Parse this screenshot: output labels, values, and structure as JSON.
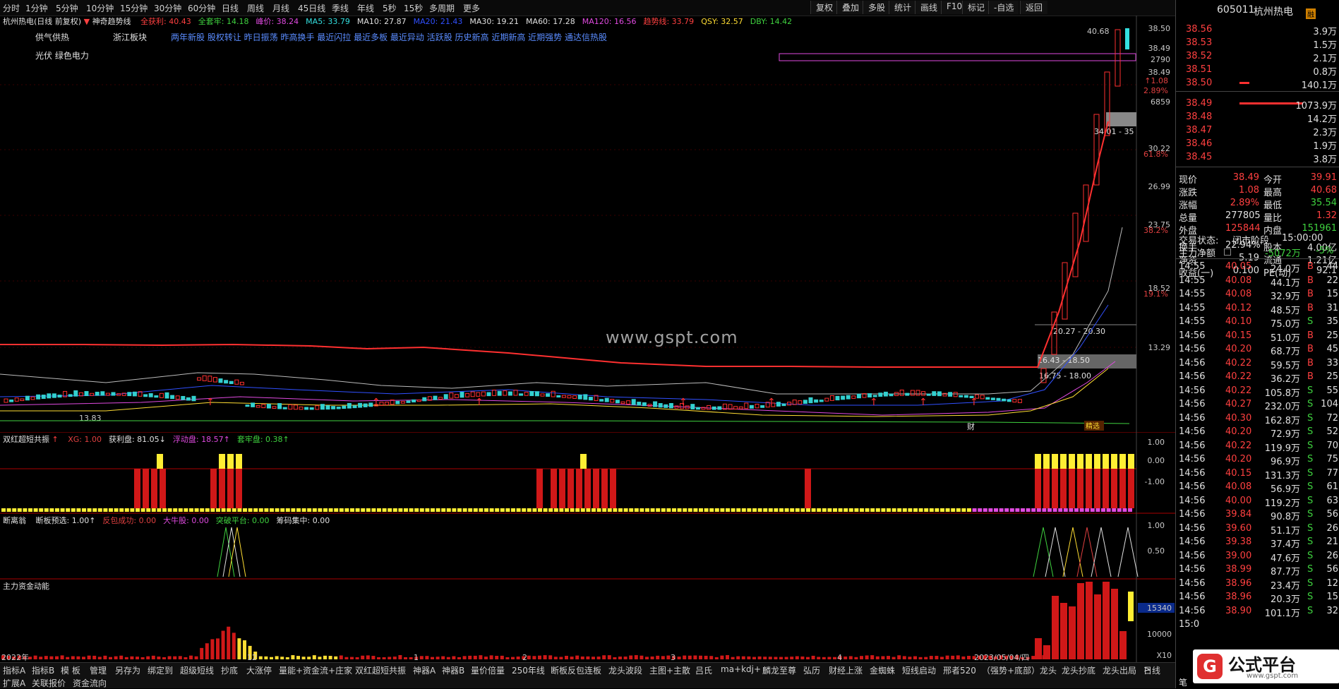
{
  "toolbar": {
    "periods": [
      "分时",
      "1分钟",
      "5分钟",
      "10分钟",
      "15分钟",
      "30分钟",
      "60分钟",
      "日线",
      "周线",
      "月线",
      "45日线",
      "季线",
      "年线",
      "5秒",
      "15秒",
      "多周期",
      "更多"
    ],
    "right_buttons": [
      "复权",
      "叠加",
      "多股",
      "统计",
      "画线",
      "F10",
      "标记",
      "-自选",
      "返回"
    ]
  },
  "main": {
    "stock_label": "杭州热电(日线 前复权)",
    "indicator_name": "神奇趋势线",
    "indicators": [
      {
        "text": "全获利: 40.43",
        "color": "#ff4040"
      },
      {
        "text": "全套牢: 14.18",
        "color": "#3fd23f"
      },
      {
        "text": "峰价: 38.24",
        "color": "#e04ae0"
      },
      {
        "text": "MA5: 33.79",
        "color": "#33e0e0"
      },
      {
        "text": "MA10: 27.87",
        "color": "#e0e0e0"
      },
      {
        "text": "MA20: 21.43",
        "color": "#3050ff"
      },
      {
        "text": "MA30: 19.21",
        "color": "#e0e0e0"
      },
      {
        "text": "MA60: 17.28",
        "color": "#e0e0e0"
      },
      {
        "text": "MA120: 16.56",
        "color": "#e04ae0"
      },
      {
        "text": "趋势线: 33.79",
        "color": "#ff4040"
      },
      {
        "text": "QSY: 32.57",
        "color": "#ffdd33"
      },
      {
        "text": "DBY: 14.42",
        "color": "#3fd23f"
      }
    ],
    "concept1": "供气供热",
    "concept2": "浙江板块",
    "concept3": "光伏 绿色电力",
    "tags": "两年新股 股权转让 昨日振荡 昨高换手 最近闪拉 最近多板 最近异动 活跃股 历史新高 近期新高 近期强势 通达信热股",
    "price_axis": [
      "38.50",
      "38.49",
      "2790",
      "38.49",
      "30.22",
      "26.99",
      "23.75",
      "18.52",
      "13.29"
    ],
    "pct_labels": [
      "↑1.08",
      "2.89%",
      "61.8%",
      "38.2%",
      "19.1%"
    ],
    "axis_extra": "6859",
    "high_label": "40.68",
    "low_label": "13.83",
    "range_labels": [
      "34.01 - 35",
      "20.27 - 20.30",
      "16.43 - 18.50",
      "16.75 - 18.00"
    ],
    "caption_cai": "财",
    "caption_jz": "精选",
    "watermark": "www.gspt.com",
    "dates": [
      "2022年",
      "12",
      "1",
      "2",
      "3",
      "4",
      "2023/05/04/四"
    ]
  },
  "panel1": {
    "title": "双红超短共振",
    "items": [
      {
        "text": "XG: 1.00",
        "color": "#e04040"
      },
      {
        "text": "获利盘: 81.05↓",
        "color": "#e0e0e0"
      },
      {
        "text": "浮动盘: 18.57↑",
        "color": "#e04ae0"
      },
      {
        "text": "套牢盘: 0.38↑",
        "color": "#3fd23f"
      }
    ],
    "axis": [
      "1.00",
      "0.00",
      "-1.00"
    ]
  },
  "panel2": {
    "title": "断离翁",
    "items": [
      {
        "text": "断板预选: 1.00↑",
        "color": "#e0e0e0"
      },
      {
        "text": "反包成功: 0.00",
        "color": "#e04040"
      },
      {
        "text": "大牛股: 0.00",
        "color": "#e04ae0"
      },
      {
        "text": "突破平台: 0.00",
        "color": "#3fd23f"
      },
      {
        "text": "筹码集中: 0.00",
        "color": "#e0e0e0"
      }
    ],
    "axis": [
      "1.00",
      "0.50"
    ]
  },
  "panel3": {
    "title": "主力资金动能",
    "axis": [
      "15340",
      "10000",
      "X10"
    ]
  },
  "tabs_row1": [
    "指标A",
    "指标B",
    "模 板",
    "管理",
    "另存为",
    "绑定到",
    "超级短线",
    "抄底",
    "大涨停",
    "量能+资金流+庄家",
    "双红超短共振",
    "神器A",
    "神器B",
    "量价倍量",
    "250年线",
    "断板反包连板",
    "龙头波段",
    "主图+主散",
    "吕氏",
    "ma+kdj+",
    "麟龙至尊",
    "弘历",
    "财经上涨",
    "金蜘蛛",
    "短线启动",
    "邢者520",
    "（强势+底部）龙头",
    "龙头抄底",
    "龙头出局",
    ">"
  ],
  "tabs_row2": [
    "扩展A",
    "关联报价",
    "资金流向"
  ],
  "tabs_right": "日线",
  "right_panel": {
    "code": "605011",
    "name": "杭州热电",
    "badge": "融",
    "asks": [
      {
        "label": "38.56",
        "vol": "3.9万"
      },
      {
        "label": "38.53",
        "vol": "1.5万"
      },
      {
        "label": "38.52",
        "vol": "2.1万"
      },
      {
        "label": "38.51",
        "vol": "0.8万"
      },
      {
        "label": "38.50",
        "vol": "140.1万"
      }
    ],
    "bids": [
      {
        "label": "38.49",
        "vol": "1073.9万"
      },
      {
        "label": "38.48",
        "vol": "14.2万"
      },
      {
        "label": "38.47",
        "vol": "2.3万"
      },
      {
        "label": "38.46",
        "vol": "1.9万"
      },
      {
        "label": "38.45",
        "vol": "3.8万"
      }
    ],
    "stats": [
      {
        "k1": "现价",
        "v1": "38.49",
        "c1": "red",
        "k2": "今开",
        "v2": "39.91",
        "c2": "red"
      },
      {
        "k1": "涨跌",
        "v1": "1.08",
        "c1": "red",
        "k2": "最高",
        "v2": "40.68",
        "c2": "red"
      },
      {
        "k1": "涨幅",
        "v1": "2.89%",
        "c1": "red",
        "k2": "最低",
        "v2": "35.54",
        "c2": "grn"
      },
      {
        "k1": "总量",
        "v1": "277805",
        "c1": "wht",
        "k2": "量比",
        "v2": "1.32",
        "c2": "red"
      },
      {
        "k1": "外盘",
        "v1": "125844",
        "c1": "red",
        "k2": "内盘",
        "v2": "151961",
        "c2": "grn"
      },
      {
        "k1": "换手",
        "v1": "22.94%",
        "c1": "wht",
        "k2": "股本",
        "v2": "4.00亿",
        "c2": "wht"
      },
      {
        "k1": "净资",
        "v1": "5.19",
        "c1": "wht",
        "k2": "流通",
        "v2": "1.21亿",
        "c2": "wht"
      },
      {
        "k1": "收益(一)",
        "v1": "0.100",
        "c1": "wht",
        "k2": "PE(动)",
        "v2": "92.1",
        "c2": "wht"
      }
    ],
    "trade_status_label": "交易状态:",
    "trade_status": "闭市阶段",
    "trade_time": "15:00:00",
    "main_net_label": "主力净额",
    "main_net": "-5072万",
    "main_net_pct": "-5%",
    "ticks": [
      {
        "t": "14:55",
        "p": "40.05",
        "v": "24.0万",
        "d": "B",
        "n": "44"
      },
      {
        "t": "14:55",
        "p": "40.08",
        "v": "44.1万",
        "d": "B",
        "n": "22"
      },
      {
        "t": "14:55",
        "p": "40.08",
        "v": "32.9万",
        "d": "B",
        "n": "15"
      },
      {
        "t": "14:55",
        "p": "40.12",
        "v": "48.5万",
        "d": "B",
        "n": "31"
      },
      {
        "t": "14:55",
        "p": "40.10",
        "v": "75.0万",
        "d": "S",
        "n": "35"
      },
      {
        "t": "14:56",
        "p": "40.15",
        "v": "51.0万",
        "d": "B",
        "n": "25"
      },
      {
        "t": "14:56",
        "p": "40.20",
        "v": "68.7万",
        "d": "B",
        "n": "45"
      },
      {
        "t": "14:56",
        "p": "40.22",
        "v": "59.5万",
        "d": "B",
        "n": "33"
      },
      {
        "t": "14:56",
        "p": "40.22",
        "v": "36.2万",
        "d": "B",
        "n": "25"
      },
      {
        "t": "14:56",
        "p": "40.22",
        "v": "105.8万",
        "d": "S",
        "n": "55"
      },
      {
        "t": "14:56",
        "p": "40.27",
        "v": "232.0万",
        "d": "S",
        "n": "104"
      },
      {
        "t": "14:56",
        "p": "40.30",
        "v": "162.8万",
        "d": "S",
        "n": "72"
      },
      {
        "t": "14:56",
        "p": "40.20",
        "v": "72.9万",
        "d": "S",
        "n": "52"
      },
      {
        "t": "14:56",
        "p": "40.22",
        "v": "119.9万",
        "d": "S",
        "n": "70"
      },
      {
        "t": "14:56",
        "p": "40.20",
        "v": "96.9万",
        "d": "S",
        "n": "75"
      },
      {
        "t": "14:56",
        "p": "40.15",
        "v": "131.3万",
        "d": "S",
        "n": "77"
      },
      {
        "t": "14:56",
        "p": "40.08",
        "v": "56.9万",
        "d": "S",
        "n": "61"
      },
      {
        "t": "14:56",
        "p": "40.00",
        "v": "119.2万",
        "d": "S",
        "n": "63"
      },
      {
        "t": "14:56",
        "p": "39.84",
        "v": "90.8万",
        "d": "S",
        "n": "56"
      },
      {
        "t": "14:56",
        "p": "39.60",
        "v": "51.1万",
        "d": "S",
        "n": "26"
      },
      {
        "t": "14:56",
        "p": "39.38",
        "v": "37.4万",
        "d": "S",
        "n": "21"
      },
      {
        "t": "14:56",
        "p": "39.00",
        "v": "47.6万",
        "d": "S",
        "n": "26"
      },
      {
        "t": "14:56",
        "p": "38.99",
        "v": "87.7万",
        "d": "S",
        "n": "56"
      },
      {
        "t": "14:56",
        "p": "38.96",
        "v": "23.4万",
        "d": "S",
        "n": "12"
      },
      {
        "t": "14:56",
        "p": "38.96",
        "v": "20.3万",
        "d": "S",
        "n": "15"
      },
      {
        "t": "14:56",
        "p": "38.90",
        "v": "101.1万",
        "d": "S",
        "n": "32"
      },
      {
        "t": "15:0",
        "p": "",
        "v": "",
        "d": "",
        "n": ""
      }
    ],
    "footer": "笔",
    "brand": "公式平台",
    "brand_url": "www.gspt.com"
  },
  "colors": {
    "up": "#ff4040",
    "down": "#3fd23f",
    "bg": "#000000",
    "accent": "#e04ae0"
  }
}
